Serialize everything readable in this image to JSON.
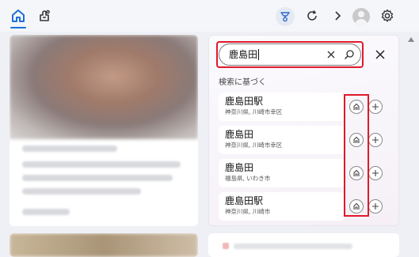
{
  "search": {
    "query": "鹿島田"
  },
  "section_label": "検索に基づく",
  "results": [
    {
      "title": "鹿島田駅",
      "subtitle": "神奈川県, 川崎市幸区"
    },
    {
      "title": "鹿島田",
      "subtitle": "神奈川県, 川崎市幸区"
    },
    {
      "title": "鹿島田",
      "subtitle": "福島県, いわき市"
    },
    {
      "title": "鹿島田駅",
      "subtitle": "神奈川県, 川崎市"
    }
  ],
  "colors": {
    "accent": "#1e6fd9",
    "highlight": "#e0192a"
  },
  "icons": [
    "home-icon",
    "puzzle-icon",
    "rewards-icon",
    "refresh-icon",
    "chevron-right-icon",
    "avatar-icon",
    "gear-icon",
    "clear-icon",
    "search-icon",
    "close-icon",
    "home-pin-icon",
    "add-icon"
  ]
}
